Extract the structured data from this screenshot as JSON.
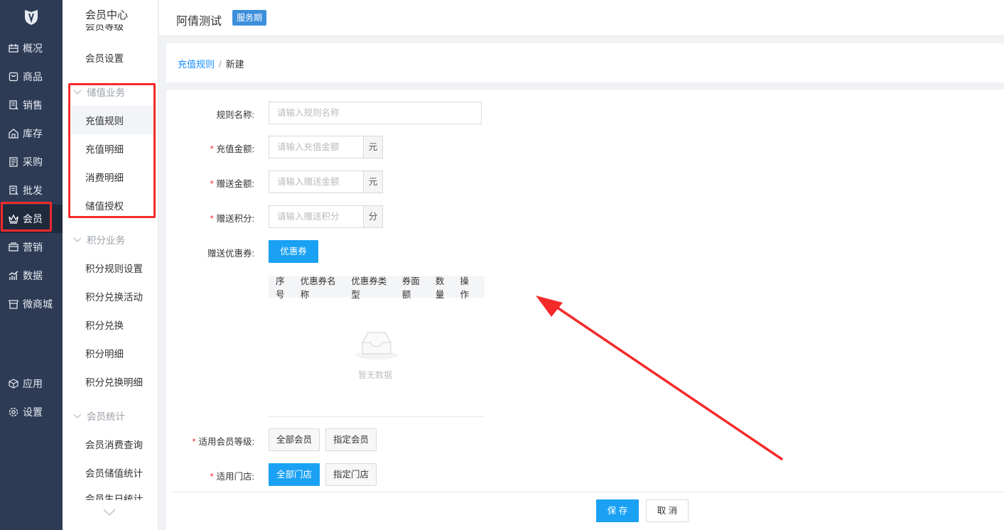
{
  "nav": {
    "items": [
      {
        "label": "概况",
        "icon": "overview-icon"
      },
      {
        "label": "商品",
        "icon": "goods-icon"
      },
      {
        "label": "销售",
        "icon": "sales-icon"
      },
      {
        "label": "库存",
        "icon": "inventory-icon"
      },
      {
        "label": "采购",
        "icon": "purchase-icon"
      },
      {
        "label": "批发",
        "icon": "wholesale-icon"
      },
      {
        "label": "会员",
        "icon": "crown-icon"
      },
      {
        "label": "营销",
        "icon": "marketing-icon"
      },
      {
        "label": "数据",
        "icon": "data-icon"
      },
      {
        "label": "微商城",
        "icon": "shop-icon"
      },
      {
        "label": "应用",
        "icon": "app-cube-icon"
      },
      {
        "label": "设置",
        "icon": "gear-icon"
      }
    ]
  },
  "submenu": {
    "title": "会员中心",
    "cut_top": "会员等级",
    "items_top": [
      "会员设置"
    ],
    "group1": "储值业务",
    "group1_items": [
      "充值规则",
      "充值明细",
      "消费明细",
      "储值授权"
    ],
    "group2": "积分业务",
    "group2_items": [
      "积分规则设置",
      "积分兑换活动",
      "积分兑换",
      "积分明细",
      "积分兑换明细"
    ],
    "group3": "会员统计",
    "group3_items": [
      "会员消费查询",
      "会员储值统计"
    ],
    "cut_bottom": "会员生日统计"
  },
  "header": {
    "shop_name": "阿倩测试",
    "badge": "服务期"
  },
  "breadcrumb": {
    "parent": "充值规则",
    "separator": "/",
    "current": "新建"
  },
  "form": {
    "rule_name": {
      "label": "规则名称:",
      "placeholder": "请输入规则名称"
    },
    "recharge_amount": {
      "label": "充值金额:",
      "placeholder": "请输入充值金额",
      "unit": "元",
      "required": "*"
    },
    "gift_amount": {
      "label": "赠送金额:",
      "placeholder": "请输入赠送金额",
      "unit": "元",
      "required": "*"
    },
    "gift_points": {
      "label": "赠送积分:",
      "placeholder": "请输入赠送积分",
      "unit": "分",
      "required": "*"
    },
    "coupon": {
      "label": "赠送优惠券:",
      "button": "优惠券"
    },
    "coupon_table": {
      "columns": [
        "序号",
        "优惠券名称",
        "优惠券类型",
        "券面额",
        "数量",
        "操作"
      ],
      "empty_text": "暂无数据"
    },
    "member_level": {
      "label": "适用会员等级:",
      "required": "*",
      "options": [
        "全部会员",
        "指定会员"
      ]
    },
    "store": {
      "label": "适用门店:",
      "required": "*",
      "options": [
        "全部门店",
        "指定门店"
      ],
      "selected": "全部门店"
    }
  },
  "footer": {
    "save": "保 存",
    "cancel": "取 消"
  },
  "colors": {
    "nav_bg": "#2d3b55",
    "primary": "#1aa1f4",
    "annotation": "#f42a2a"
  }
}
